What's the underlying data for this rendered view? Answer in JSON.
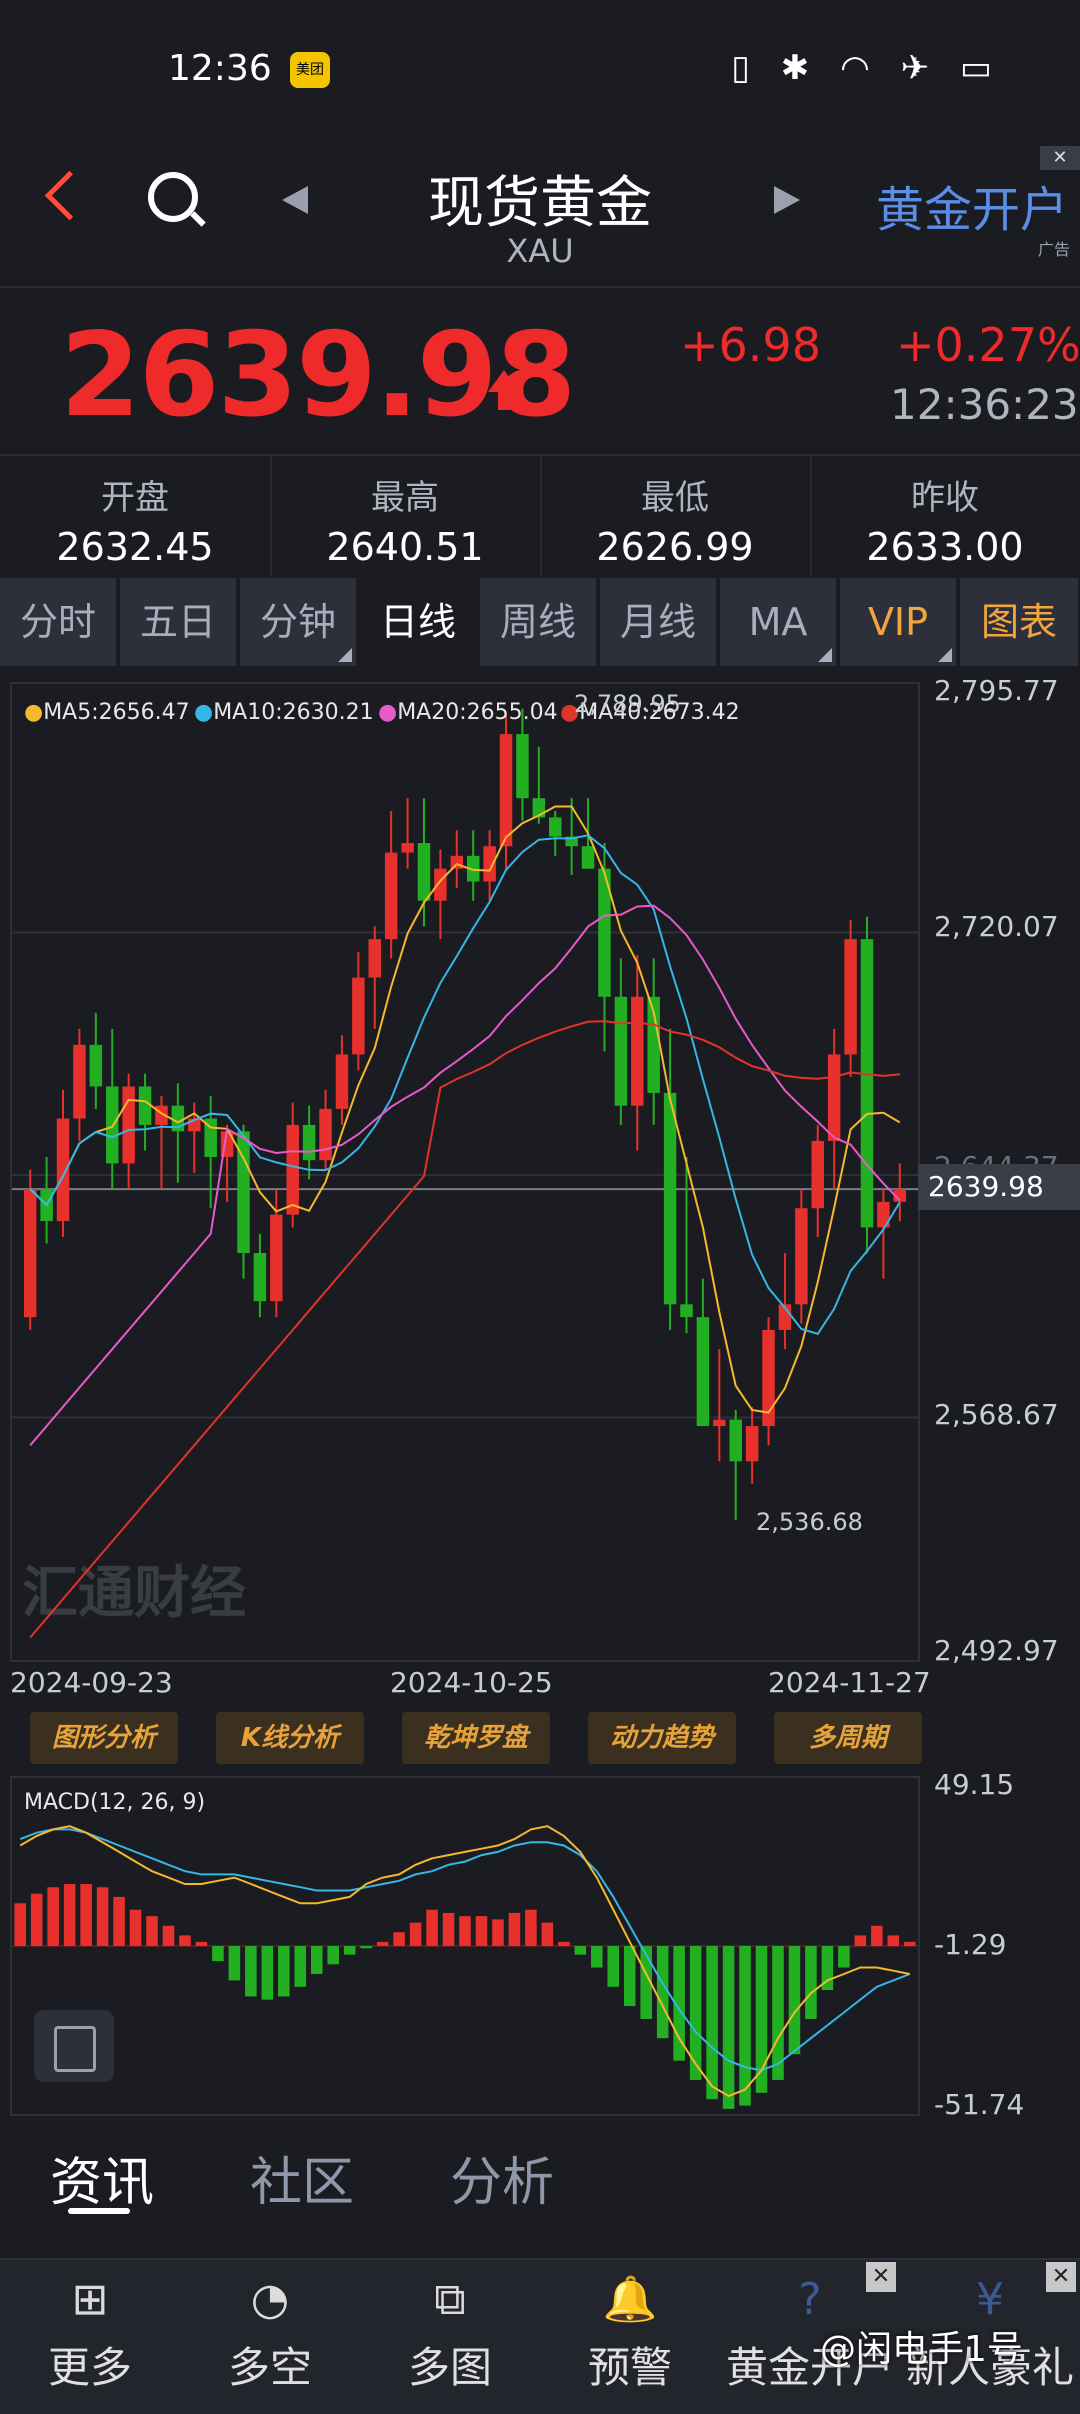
{
  "status_bar": {
    "time": "12:36",
    "app_badge": "美团"
  },
  "header": {
    "title": "现货黄金",
    "subtitle": "XAU",
    "ad_link": "黄金开户",
    "ad_tag": "广告",
    "close_symbol": "✕"
  },
  "quote": {
    "price": "2639.98",
    "change": "+6.98",
    "change_pct": "+0.27%",
    "time": "12:36:23"
  },
  "stats": [
    {
      "label": "开盘",
      "value": "2632.45"
    },
    {
      "label": "最高",
      "value": "2640.51"
    },
    {
      "label": "最低",
      "value": "2626.99"
    },
    {
      "label": "昨收",
      "value": "2633.00"
    }
  ],
  "period_tabs": [
    "分时",
    "五日",
    "分钟",
    "日线",
    "周线",
    "月线",
    "MA",
    "VIP",
    "图表"
  ],
  "active_tab": "日线",
  "ma_legend": [
    {
      "label": "MA5:2656.47",
      "color": "#f5b82e"
    },
    {
      "label": "MA10:2630.21",
      "color": "#36b6e6"
    },
    {
      "label": "MA20:2655.04",
      "color": "#e85ac8"
    },
    {
      "label": "MA40:2673.42",
      "color": "#e0332c"
    }
  ],
  "chart_data": [
    {
      "type": "candlestick",
      "y_ticks": [
        "2,795.77",
        "2,720.07",
        "2,644.37",
        "2,568.67",
        "2,492.97"
      ],
      "ylim": [
        2492.97,
        2795.77
      ],
      "x_labels": [
        "2024-09-23",
        "2024-10-25",
        "2024-11-27"
      ],
      "current_price": "2639.98",
      "max_label": "2,789.95",
      "min_label": "2,536.68",
      "up_color": "#e8302c",
      "down_color": "#22b022",
      "candles": [
        [
          2600,
          2646,
          2596,
          2640
        ],
        [
          2640,
          2650,
          2623,
          2630
        ],
        [
          2630,
          2671,
          2625,
          2662
        ],
        [
          2662,
          2690,
          2655,
          2685
        ],
        [
          2685,
          2695,
          2665,
          2672
        ],
        [
          2672,
          2690,
          2640,
          2648
        ],
        [
          2648,
          2676,
          2640,
          2672
        ],
        [
          2672,
          2676,
          2652,
          2660
        ],
        [
          2660,
          2669,
          2640,
          2666
        ],
        [
          2666,
          2673,
          2642,
          2658
        ],
        [
          2658,
          2667,
          2645,
          2662
        ],
        [
          2662,
          2669,
          2634,
          2650
        ],
        [
          2650,
          2660,
          2636,
          2658
        ],
        [
          2658,
          2660,
          2612,
          2620
        ],
        [
          2620,
          2626,
          2600,
          2605
        ],
        [
          2605,
          2640,
          2600,
          2632
        ],
        [
          2632,
          2667,
          2628,
          2660
        ],
        [
          2660,
          2666,
          2643,
          2649
        ],
        [
          2649,
          2671,
          2646,
          2665
        ],
        [
          2665,
          2688,
          2660,
          2682
        ],
        [
          2682,
          2714,
          2677,
          2706
        ],
        [
          2706,
          2722,
          2690,
          2718
        ],
        [
          2718,
          2758,
          2712,
          2745
        ],
        [
          2745,
          2762,
          2740,
          2748
        ],
        [
          2748,
          2762,
          2722,
          2730
        ],
        [
          2730,
          2746,
          2718,
          2740
        ],
        [
          2740,
          2752,
          2734,
          2744
        ],
        [
          2744,
          2752,
          2730,
          2736
        ],
        [
          2736,
          2752,
          2730,
          2747
        ],
        [
          2747,
          2788,
          2740,
          2782
        ],
        [
          2782,
          2789.95,
          2755,
          2762
        ],
        [
          2762,
          2778,
          2754,
          2756
        ],
        [
          2756,
          2758,
          2744,
          2750
        ],
        [
          2750,
          2762,
          2738,
          2747
        ],
        [
          2747,
          2762,
          2740,
          2740
        ],
        [
          2740,
          2748,
          2683,
          2700
        ],
        [
          2700,
          2712,
          2660,
          2666
        ],
        [
          2666,
          2713,
          2652,
          2700
        ],
        [
          2700,
          2712,
          2660,
          2670
        ],
        [
          2670,
          2690,
          2596,
          2604
        ],
        [
          2604,
          2650,
          2595,
          2600
        ],
        [
          2600,
          2612,
          2572,
          2566
        ],
        [
          2566,
          2590,
          2555,
          2568
        ],
        [
          2568,
          2571,
          2536.68,
          2555
        ],
        [
          2555,
          2572,
          2548,
          2566
        ],
        [
          2566,
          2600,
          2560,
          2596
        ],
        [
          2596,
          2620,
          2590,
          2604
        ],
        [
          2604,
          2640,
          2598,
          2634
        ],
        [
          2634,
          2660,
          2625,
          2655
        ],
        [
          2655,
          2690,
          2640,
          2682
        ],
        [
          2682,
          2724,
          2675,
          2718
        ],
        [
          2718,
          2725,
          2620,
          2628
        ],
        [
          2628,
          2640,
          2612,
          2636
        ],
        [
          2636,
          2648,
          2630,
          2640
        ]
      ]
    },
    {
      "type": "bar",
      "title": "MACD(12, 26, 9)",
      "y_ticks": [
        "49.15",
        "-1.29",
        "-51.74"
      ],
      "ylim": [
        -51.74,
        49.15
      ],
      "values": [
        12,
        15,
        17,
        18,
        18,
        17,
        14,
        10,
        8,
        5,
        2,
        0,
        -6,
        -12,
        -17,
        -18,
        -17,
        -14,
        -10,
        -7,
        -4,
        -2,
        0,
        3,
        6,
        10,
        9,
        8,
        8,
        7,
        9,
        10,
        6,
        0,
        -4,
        -8,
        -14,
        -20,
        -24,
        -30,
        -37,
        -43,
        -49,
        -52,
        -51,
        -47,
        -43,
        -35,
        -24,
        -15,
        -8,
        2,
        5,
        2,
        0
      ],
      "dif": [
        30,
        33,
        35,
        36,
        34,
        31,
        28,
        25,
        22,
        20,
        18,
        18,
        19,
        20,
        18,
        16,
        14,
        12,
        12,
        13,
        14,
        18,
        20,
        21,
        24,
        26,
        27,
        28,
        29,
        30,
        32,
        35,
        36,
        33,
        28,
        20,
        10,
        0,
        -10,
        -20,
        -30,
        -38,
        -45,
        -48,
        -46,
        -40,
        -30,
        -22,
        -16,
        -12,
        -10,
        -8,
        -8,
        -9,
        -10
      ],
      "dea": [
        32,
        34,
        35,
        35,
        34,
        32,
        30,
        28,
        26,
        24,
        22,
        21,
        21,
        21,
        20,
        19,
        18,
        17,
        16,
        16,
        16,
        17,
        18,
        19,
        21,
        22,
        24,
        25,
        27,
        28,
        30,
        31,
        31,
        30,
        27,
        22,
        14,
        5,
        -4,
        -13,
        -21,
        -28,
        -33,
        -37,
        -39,
        -40,
        -38,
        -34,
        -30,
        -26,
        -22,
        -18,
        -14,
        -12,
        -10
      ]
    }
  ],
  "analysis_buttons": [
    "图形分析",
    "K线分析",
    "乾坤罗盘",
    "动力趋势",
    "多周期"
  ],
  "watermark": "汇通财经",
  "news_tabs": [
    "资讯",
    "社区",
    "分析"
  ],
  "bottom_nav": [
    {
      "label": "更多",
      "icon": "grid-icon",
      "glyph": "⊞"
    },
    {
      "label": "多空",
      "icon": "trend-icon",
      "glyph": "◔"
    },
    {
      "label": "多图",
      "icon": "multi-chart-icon",
      "glyph": "⧉"
    },
    {
      "label": "预警",
      "icon": "bell-icon",
      "glyph": "🔔"
    },
    {
      "label": "黄金开户",
      "icon": "gold-account-icon",
      "glyph": "?"
    },
    {
      "label": "新人豪礼",
      "icon": "gift-icon",
      "glyph": "¥"
    }
  ],
  "overlay_watermark": "@闲电手1号"
}
